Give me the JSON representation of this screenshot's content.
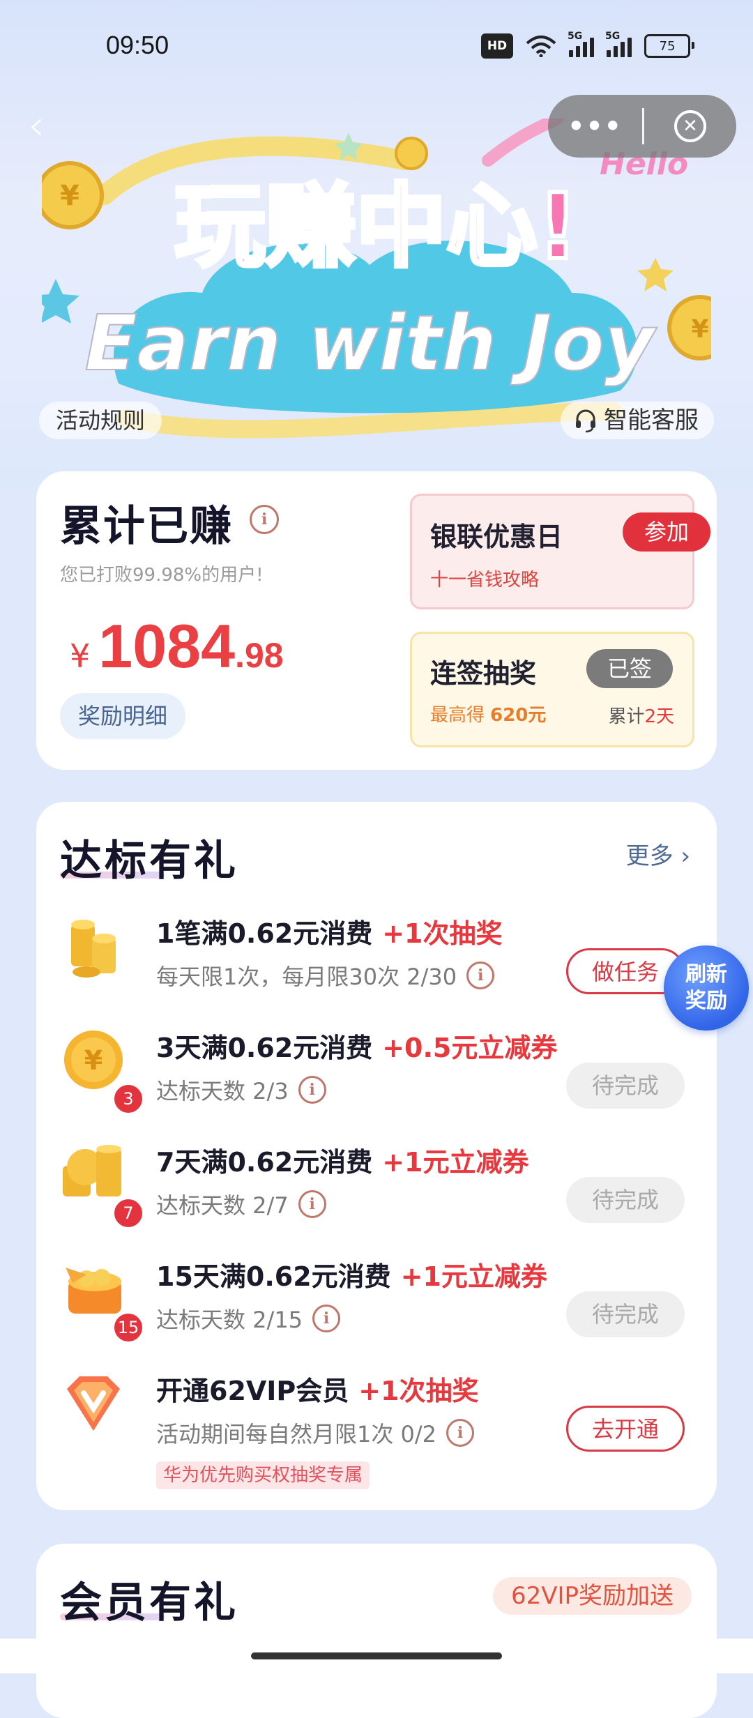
{
  "status_bar": {
    "time": "09:50",
    "battery": "75",
    "network_labels": [
      "HD",
      "5G",
      "5G"
    ]
  },
  "hero": {
    "title_cn": "玩赚中心!",
    "title_en": "Earn with Joy",
    "hello": "Hello"
  },
  "header": {
    "rules_label": "活动规则",
    "service_label": "智能客服"
  },
  "earnings": {
    "title": "累计已赚",
    "subtitle": "您已打败99.98%的用户!",
    "currency": "¥",
    "amount_int": "1084",
    "amount_dec": ".98",
    "detail_label": "奖励明细"
  },
  "unionpay": {
    "title": "银联优惠日",
    "button": "参加",
    "subtitle": "十一省钱攻略"
  },
  "signin": {
    "title": "连签抽奖",
    "button": "已签",
    "reward_prefix": "最高得",
    "reward_value": "620元",
    "count_prefix": "累计",
    "count_value": "2天"
  },
  "tasks": {
    "title": "达标有礼",
    "more_label": "更多 ›",
    "items": [
      {
        "title": "1笔满0.62元消费",
        "reward": "+1次抽奖",
        "desc": "每天限1次，每月限30次 2/30",
        "button": "做任务",
        "badge": ""
      },
      {
        "title": "3天满0.62元消费",
        "reward": "+0.5元立减券",
        "desc": "达标天数 2/3",
        "button": "待完成",
        "badge": "3"
      },
      {
        "title": "7天满0.62元消费",
        "reward": "+1元立减券",
        "desc": "达标天数 2/7",
        "button": "待完成",
        "badge": "7"
      },
      {
        "title": "15天满0.62元消费",
        "reward": "+1元立减券",
        "desc": "达标天数 2/15",
        "button": "待完成",
        "badge": "15"
      },
      {
        "title": "开通62VIP会员",
        "reward": "+1次抽奖",
        "desc": "活动期间每自然月限1次 0/2",
        "button": "去开通",
        "badge": "",
        "tag": "华为优先购买权抽奖专属"
      }
    ]
  },
  "refresh_bubble": {
    "line1": "刷新",
    "line2": "奖励"
  },
  "member": {
    "title": "会员有礼",
    "tag": "62VIP奖励加送"
  },
  "colors": {
    "accent_red": "#e8383d",
    "primary_blue": "#3165e8",
    "page_bg": "#dfe9fb"
  }
}
